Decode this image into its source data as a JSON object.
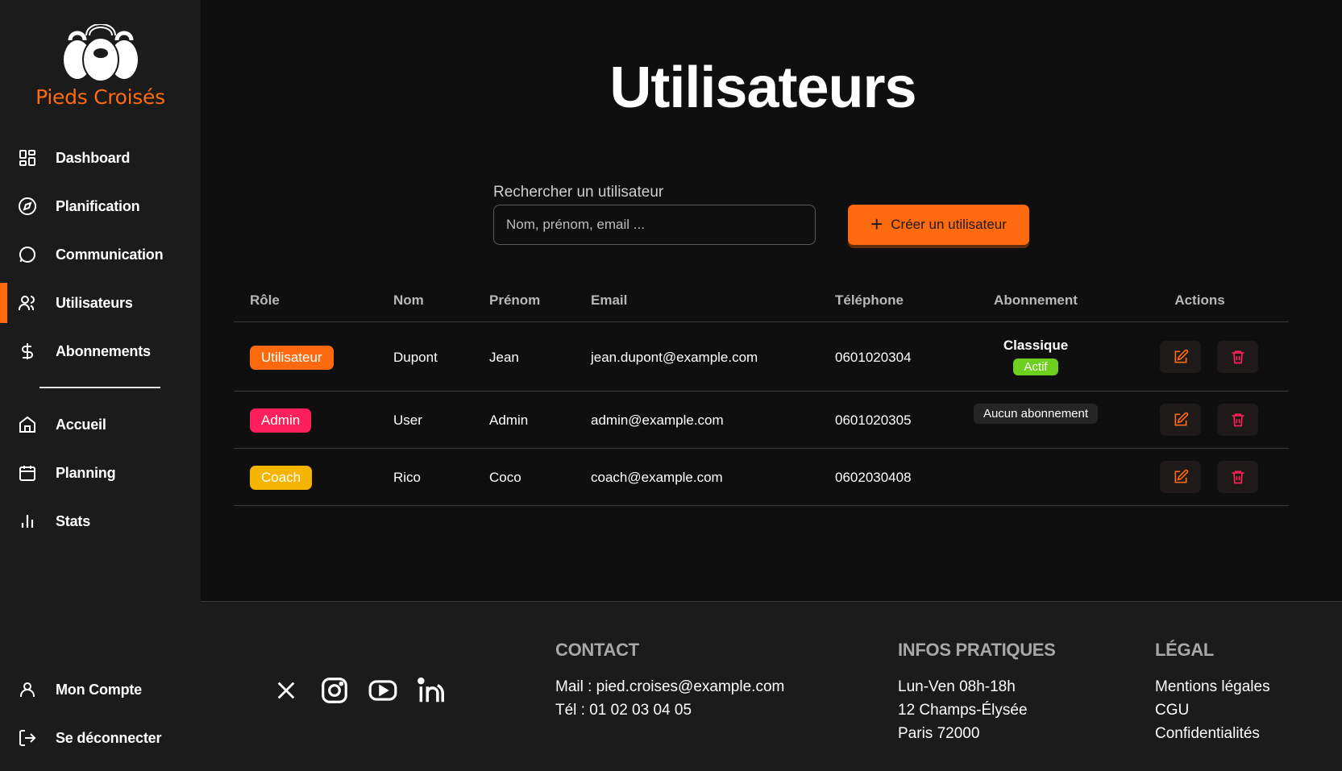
{
  "brand": {
    "name": "Pieds Croisés",
    "logo_icon": "kettlebell-icon",
    "accent": "#ff6a0f"
  },
  "sidebar": {
    "items": [
      {
        "label": "Dashboard",
        "icon": "dashboard-icon"
      },
      {
        "label": "Planification",
        "icon": "compass-icon"
      },
      {
        "label": "Communication",
        "icon": "chat-icon"
      },
      {
        "label": "Utilisateurs",
        "icon": "users-icon",
        "active": true
      },
      {
        "label": "Abonnements",
        "icon": "dollar-icon"
      },
      {
        "label": "Accueil",
        "icon": "home-icon"
      },
      {
        "label": "Planning",
        "icon": "calendar-icon"
      },
      {
        "label": "Stats",
        "icon": "bar-chart-icon"
      }
    ],
    "bottom": [
      {
        "label": "Mon Compte",
        "icon": "user-icon"
      },
      {
        "label": "Se déconnecter",
        "icon": "logout-icon"
      }
    ]
  },
  "page": {
    "title": "Utilisateurs"
  },
  "search": {
    "label": "Rechercher un utilisateur",
    "placeholder": "Nom, prénom, email ...",
    "value": ""
  },
  "create_button": {
    "label": "Créer un utilisateur",
    "icon": "plus-icon"
  },
  "table": {
    "headers": [
      "Rôle",
      "Nom",
      "Prénom",
      "Email",
      "Téléphone",
      "Abonnement",
      "Actions"
    ],
    "rows": [
      {
        "role": "Utilisateur",
        "role_color": "#ff6a0f",
        "nom": "Dupont",
        "prenom": "Jean",
        "email": "jean.dupont@example.com",
        "telephone": "0601020304",
        "abonnement": "Classique",
        "abonnement_status": "Actif",
        "abonnement_status_color": "#6fcf1e"
      },
      {
        "role": "Admin",
        "role_color": "#ff1f5a",
        "nom": "User",
        "prenom": "Admin",
        "email": "admin@example.com",
        "telephone": "0601020305",
        "abonnement_none": "Aucun abonnement"
      },
      {
        "role": "Coach",
        "role_color": "#f4b400",
        "nom": "Rico",
        "prenom": "Coco",
        "email": "coach@example.com",
        "telephone": "0602030408"
      }
    ],
    "actions": {
      "edit_icon": "edit-icon",
      "delete_icon": "trash-icon",
      "edit_color": "#ff6a0f",
      "delete_color": "#ff1f5a"
    }
  },
  "footer": {
    "social": [
      "x-icon",
      "instagram-icon",
      "youtube-icon",
      "linkedin-icon"
    ],
    "contact": {
      "heading": "CONTACT",
      "mail": "Mail : pied.croises@example.com",
      "tel": "Tél : 01 02 03 04 05"
    },
    "infos": {
      "heading": "INFOS PRATIQUES",
      "hours": "Lun-Ven 08h-18h",
      "address1": "12 Champs-Élysée",
      "address2": "Paris 72000"
    },
    "legal": {
      "heading": "LÉGAL",
      "links": [
        "Mentions légales",
        "CGU",
        "Confidentialités"
      ]
    }
  }
}
